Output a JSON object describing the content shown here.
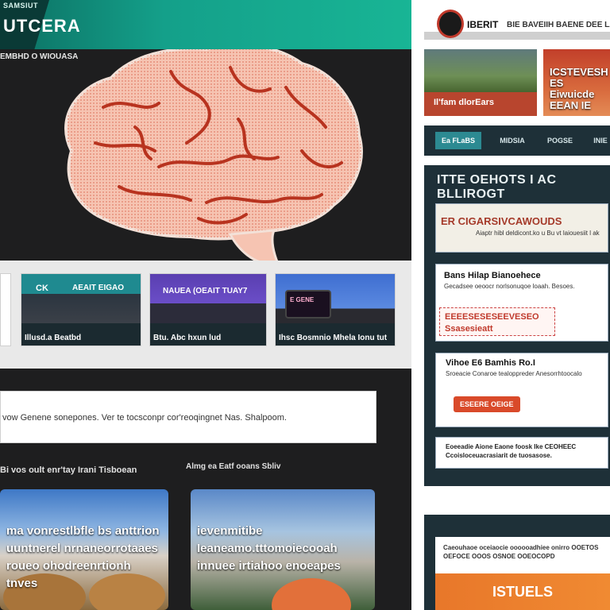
{
  "header": {
    "site_label": "SAMSIUT",
    "site_title": "UTCERA",
    "subnav": "EMBHD O WIOUASA"
  },
  "card_strip": {
    "cards": [
      {
        "tag": "CK",
        "label": "AEAIT EIGAO",
        "caption": "Illusd.a Beatbd"
      },
      {
        "tag": "",
        "label": "NAUEA (OEAIT TUAY7",
        "caption": "Btu. Abc hxun lud"
      },
      {
        "tag": "",
        "label": "",
        "caption": "Ihsc Bosmnio Mhela Ionu tut"
      }
    ],
    "screen_text": "E GENE"
  },
  "search": {
    "value": "vow Genene sonepones. Ver te tocsconpr cor'reoqingnet Nas. Shalpoom."
  },
  "sections": {
    "left_title": "Bi vos oult enr'tay Irani Tisboean",
    "right_title": "Almg ea Eatf ooans Sbliv"
  },
  "feature_cards": [
    {
      "text": "ma vonrestlbfle bs anttrion uuntnerel nrnaneorrotaaes roueo ohodreenrtionh tnves"
    },
    {
      "text": "ievenmitibe Ieaneamo.tttomoiecooah innuee irtiahoo enoeapes"
    }
  ],
  "right": {
    "brand": "IBERIT",
    "tagline": "BIE BAVEIIH BAENE DEE LANE",
    "thumb1_caption": "Il'fam dlorEars",
    "thumb2_caption": "ICSTEVESH ES Eiwuicde EEAN IE",
    "tabs": [
      "Ea FLaBS",
      "MIDSIA",
      "POGSE",
      "INIE"
    ],
    "panel_title": "ITTE OEHOTS I AC BLLIROGT",
    "box1_title": "ER CIGARSIVCAWOUDS",
    "box1_sub": "Aiaptr hibl deldicont.ko u Bu vt laiouesiit l ak",
    "box2_title": "Bans Hilap Bianoehece",
    "box2_text": "Gecadsee oeoocr norlsonuqoe loaah. Besoes.",
    "box2_badge": "EEEESESESEEVESEO Ssasesieatt",
    "box3_title": "Vihoe E6 Bamhis Ro.I",
    "box3_text": "Sroeacie Conaroe tealoppreder Anesorrhtoocalo",
    "box3_button": "ESEERE OEIGE",
    "box4_text": "Eoeeadie Aione Eaone foosk Ike CEOHEEC Ccoisloceuacrasiarit de tuosasose.",
    "bottom_text": "Caeouhaoe oceiaocie oooooadhiee onirro OOETOS OEFOCE OOOS OSNOE OOEOCOPD",
    "bottom_banner": "ISTUELS"
  }
}
